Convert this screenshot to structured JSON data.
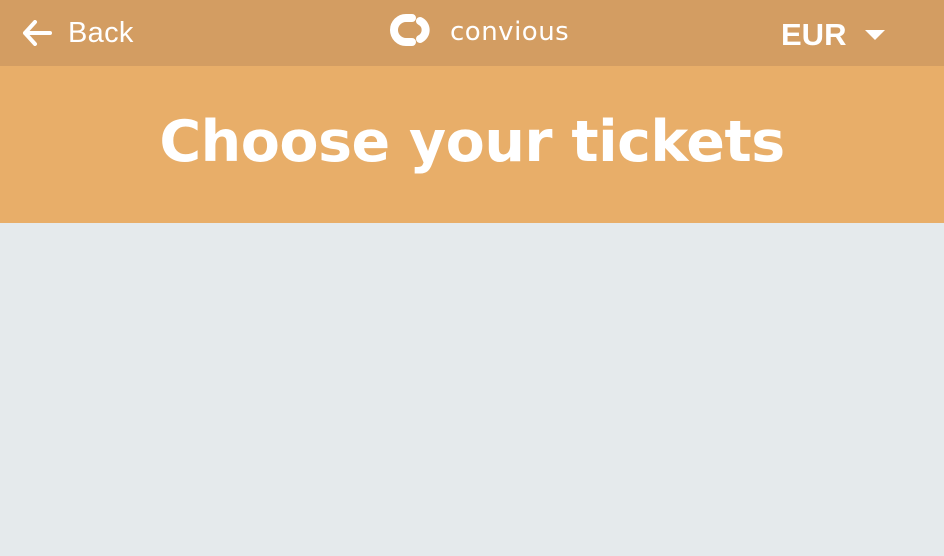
{
  "topbar": {
    "back_label": "Back",
    "logo_text": "convious",
    "currency": "EUR",
    "background": "#d39d62"
  },
  "header": {
    "title": "Choose your tickets",
    "background": "#e8ae69"
  },
  "content": {
    "background": "#e5eaec"
  },
  "icons": {
    "back": "arrow-left-icon",
    "logo": "convious-logo-icon",
    "dropdown": "caret-down-icon"
  }
}
